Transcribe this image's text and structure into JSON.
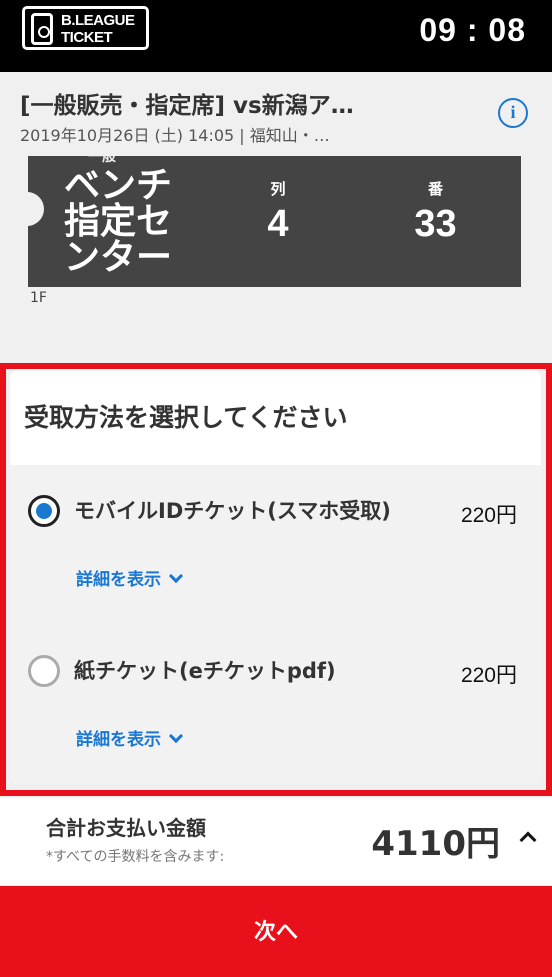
{
  "header": {
    "logo_text_line1": "B.LEAGUE",
    "logo_text_line2": "TICKET",
    "time": "09 : 08"
  },
  "event": {
    "title": "[一般販売・指定席] vs新潟ア…",
    "meta": "2019年10月26日 (土) 14:05 | 福知山・…",
    "info_icon": "info-icon"
  },
  "seat": {
    "area_label": "一般",
    "name": "ベンチ指定センター",
    "row_label": "列",
    "row_value": "4",
    "number_label": "番",
    "number_value": "33",
    "floor": "1F"
  },
  "method_panel": {
    "title": "受取方法を選択してください",
    "options": [
      {
        "label": "モバイルIDチケット(スマホ受取)",
        "price": "220円",
        "detail_link": "詳細を表示",
        "selected": true
      },
      {
        "label": "紙チケット(eチケットpdf)",
        "price": "220円",
        "detail_link": "詳細を表示",
        "selected": false
      }
    ]
  },
  "footer": {
    "total_label": "合計お支払い金額",
    "total_note": "*すべての手数料を含みます:",
    "total_amount": "4110円",
    "next_button": "次へ"
  },
  "colors": {
    "accent_red": "#e8101a",
    "link_blue": "#1a78d2",
    "seat_card": "#444444"
  }
}
